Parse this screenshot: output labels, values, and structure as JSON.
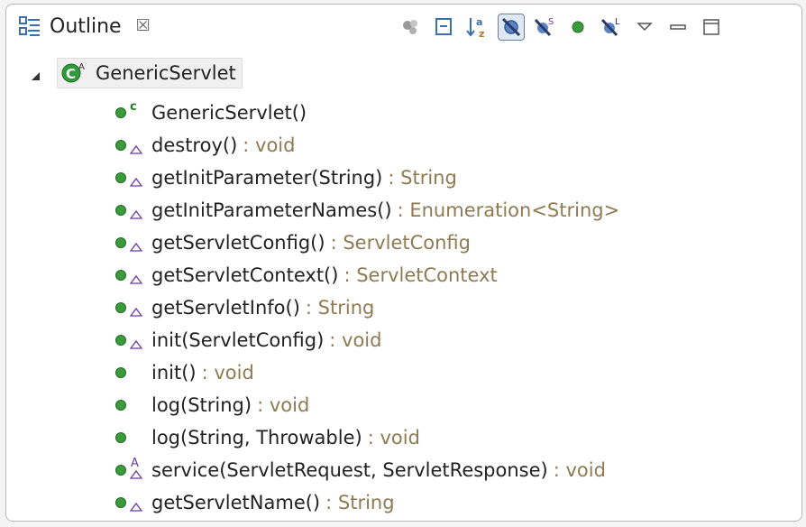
{
  "view": {
    "title": "Outline",
    "close_symbol": "☒"
  },
  "toolbar": [
    {
      "name": "collapse-group-icon",
      "active": false
    },
    {
      "name": "collapse-all-icon",
      "active": false
    },
    {
      "name": "sort-alphabetically-icon",
      "active": false
    },
    {
      "name": "hide-fields-icon",
      "active": true
    },
    {
      "name": "hide-static-members-icon",
      "active": false
    },
    {
      "name": "hide-non-public-members-icon",
      "active": false
    },
    {
      "name": "hide-local-types-icon",
      "active": false
    },
    {
      "name": "view-menu-icon",
      "active": false
    },
    {
      "name": "minimize-icon",
      "active": false
    },
    {
      "name": "maximize-icon",
      "active": false
    }
  ],
  "tree": {
    "root": {
      "label": "GenericServlet",
      "icon": "class-icon",
      "overlay": "A",
      "expanded": true
    },
    "members": [
      {
        "name": "GenericServlet()",
        "type": "",
        "overlay": "constructor"
      },
      {
        "name": "destroy()",
        "type": ": void",
        "overlay": "override"
      },
      {
        "name": "getInitParameter(String)",
        "type": ": String",
        "overlay": "override"
      },
      {
        "name": "getInitParameterNames()",
        "type": ": Enumeration<String>",
        "overlay": "override"
      },
      {
        "name": "getServletConfig()",
        "type": ": ServletConfig",
        "overlay": "override"
      },
      {
        "name": "getServletContext()",
        "type": ": ServletContext",
        "overlay": "override"
      },
      {
        "name": "getServletInfo()",
        "type": ": String",
        "overlay": "override"
      },
      {
        "name": "init(ServletConfig)",
        "type": ": void",
        "overlay": "override"
      },
      {
        "name": "init()",
        "type": ": void",
        "overlay": "none"
      },
      {
        "name": "log(String)",
        "type": ": void",
        "overlay": "none"
      },
      {
        "name": "log(String, Throwable)",
        "type": ": void",
        "overlay": "none"
      },
      {
        "name": "service(ServletRequest, ServletResponse)",
        "type": ": void",
        "overlay": "abstract"
      },
      {
        "name": "getServletName()",
        "type": ": String",
        "overlay": "override"
      }
    ]
  },
  "colors": {
    "method_public": "#3b9a3b",
    "return_type": "#8f7a52",
    "override_marker": "#6b3aa5",
    "constructor_marker": "#1f7f1f"
  }
}
